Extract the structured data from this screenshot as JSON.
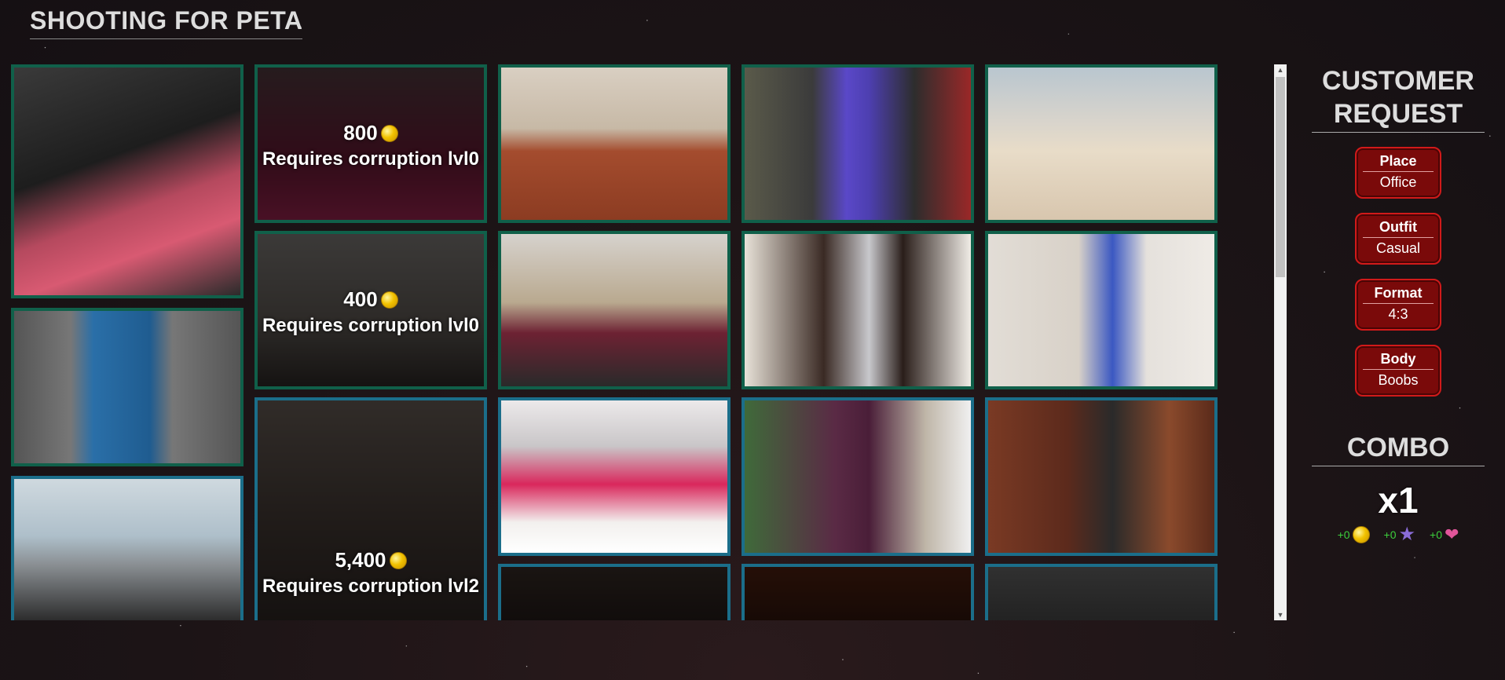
{
  "page_title": "SHOOTING FOR PETA",
  "gallery": {
    "columns": [
      [
        {
          "state": "unlocked",
          "frame": "green",
          "alt": "photo-car"
        },
        {
          "state": "unlocked",
          "frame": "green",
          "alt": "photo-costume"
        },
        {
          "state": "unlocked",
          "frame": "blue",
          "alt": "photo-window"
        }
      ],
      [
        {
          "state": "locked",
          "frame": "green",
          "price": "800",
          "requirement": "Requires corruption lvl0"
        },
        {
          "state": "locked",
          "frame": "green",
          "price": "400",
          "requirement": "Requires corruption lvl0"
        },
        {
          "state": "locked",
          "frame": "blue",
          "price": "5,400",
          "requirement": "Requires corruption lvl2"
        }
      ],
      [
        {
          "state": "unlocked",
          "frame": "green",
          "alt": "photo-office"
        },
        {
          "state": "unlocked",
          "frame": "green",
          "alt": "photo-bedroom"
        },
        {
          "state": "unlocked",
          "frame": "blue",
          "alt": "photo-bed"
        },
        {
          "state": "locked",
          "frame": "blue",
          "price": "",
          "requirement": ""
        }
      ],
      [
        {
          "state": "unlocked",
          "frame": "green",
          "alt": "photo-couch"
        },
        {
          "state": "unlocked",
          "frame": "green",
          "alt": "photo-headphones"
        },
        {
          "state": "unlocked",
          "frame": "blue",
          "alt": "photo-robe"
        },
        {
          "state": "locked",
          "frame": "blue",
          "price": "",
          "requirement": ""
        }
      ],
      [
        {
          "state": "unlocked",
          "frame": "green",
          "alt": "photo-beach"
        },
        {
          "state": "unlocked",
          "frame": "green",
          "alt": "photo-dining"
        },
        {
          "state": "unlocked",
          "frame": "blue",
          "alt": "photo-kitchen"
        },
        {
          "state": "locked",
          "frame": "blue",
          "price": "",
          "requirement": ""
        }
      ]
    ]
  },
  "customer_request": {
    "title": "CUSTOMER REQUEST",
    "items": [
      {
        "label": "Place",
        "value": "Office"
      },
      {
        "label": "Outfit",
        "value": "Casual"
      },
      {
        "label": "Format",
        "value": "4:3"
      },
      {
        "label": "Body",
        "value": "Boobs"
      }
    ]
  },
  "combo": {
    "title": "COMBO",
    "multiplier": "x1",
    "bonuses": [
      {
        "amount": "+0",
        "icon": "coin-icon"
      },
      {
        "amount": "+0",
        "icon": "star-icon"
      },
      {
        "amount": "+0",
        "icon": "heart-icon"
      }
    ]
  },
  "colors": {
    "frame_green": "#10604a",
    "frame_blue": "#1b6e8a",
    "request_red": "#d11a1a",
    "bonus_green": "#3cd03c"
  }
}
